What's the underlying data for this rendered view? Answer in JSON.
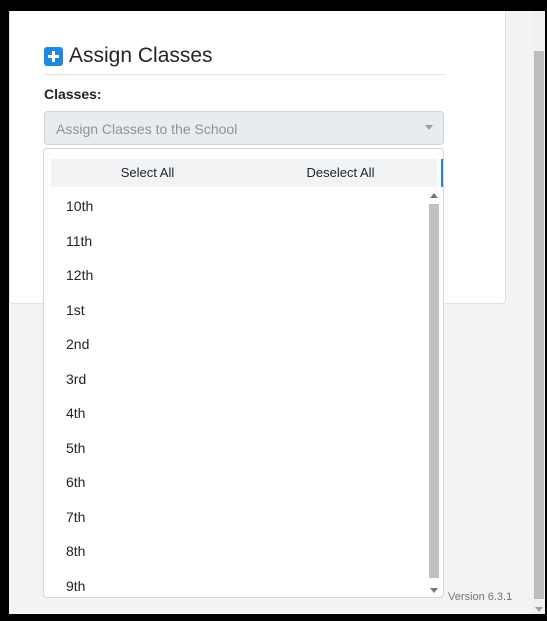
{
  "header": {
    "title": "Assign Classes",
    "icon": "plus-square-icon"
  },
  "form": {
    "classes_label": "Classes:",
    "select_placeholder": "Assign Classes to the School"
  },
  "dropdown": {
    "select_all": "Select All",
    "deselect_all": "Deselect All",
    "options": [
      "10th",
      "11th",
      "12th",
      "1st",
      "2nd",
      "3rd",
      "4th",
      "5th",
      "6th",
      "7th",
      "8th",
      "9th"
    ]
  },
  "footer": {
    "version": "Version 6.3.1"
  },
  "colors": {
    "accent": "#1e88e5"
  }
}
